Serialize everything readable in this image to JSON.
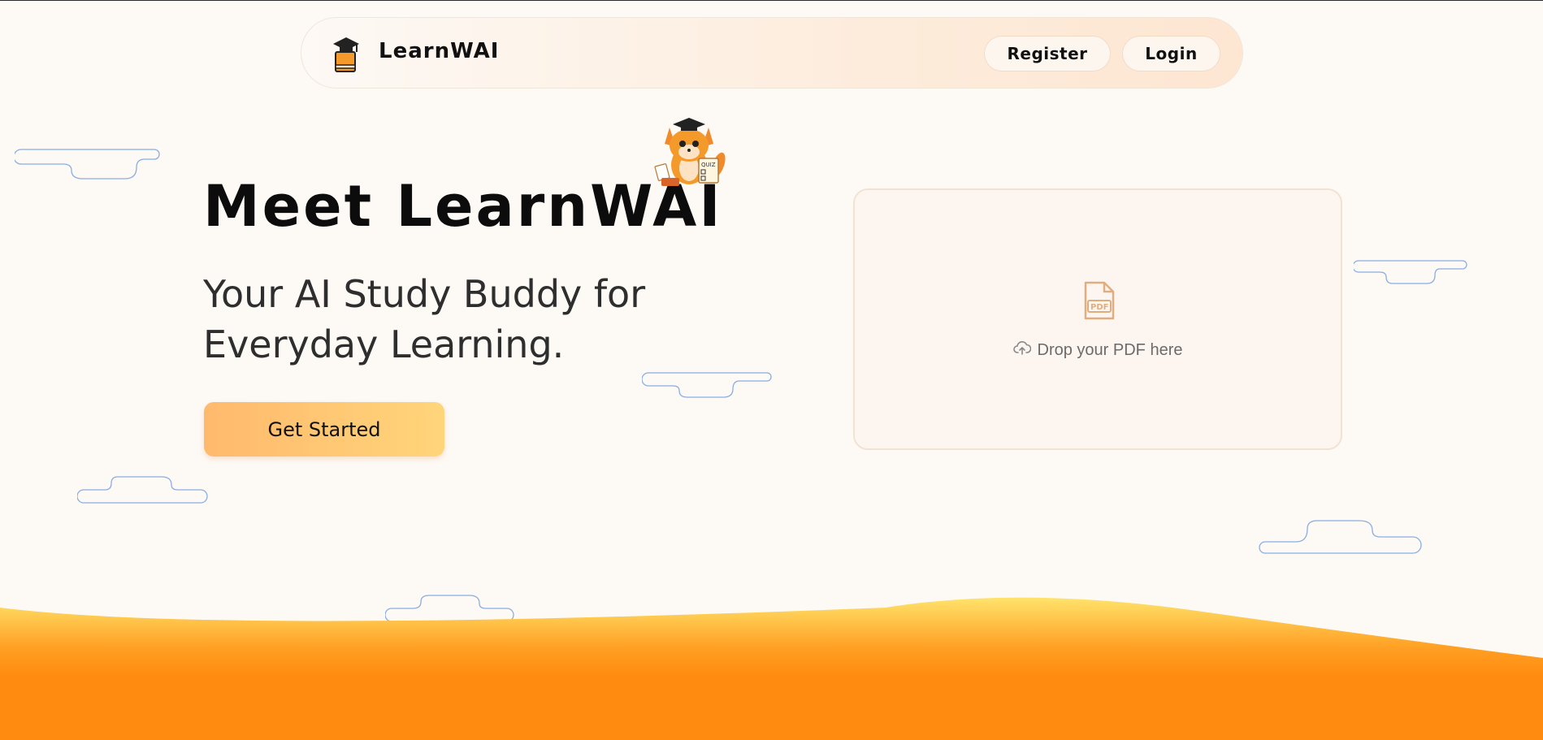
{
  "nav": {
    "brand": "LearnWAI",
    "register_label": "Register",
    "login_label": "Login",
    "logo_icon": "book-graduation-cap-icon"
  },
  "hero": {
    "title": "Meet LearnWAI",
    "subtitle": "Your AI Study Buddy for Everyday Learning.",
    "cta_label": "Get Started",
    "mascot": "fox-mascot-with-graduation-cap"
  },
  "dropzone": {
    "label": "Drop your PDF here",
    "file_icon": "pdf-file-icon",
    "upload_icon": "cloud-upload-icon"
  },
  "colors": {
    "background": "#fdf9f5",
    "accent_orange": "#ff8c10",
    "accent_yellow": "#ffe066",
    "button_gradient_start": "#ffb96d",
    "button_gradient_end": "#ffd57a",
    "cloud_outline": "#8aaee0"
  }
}
